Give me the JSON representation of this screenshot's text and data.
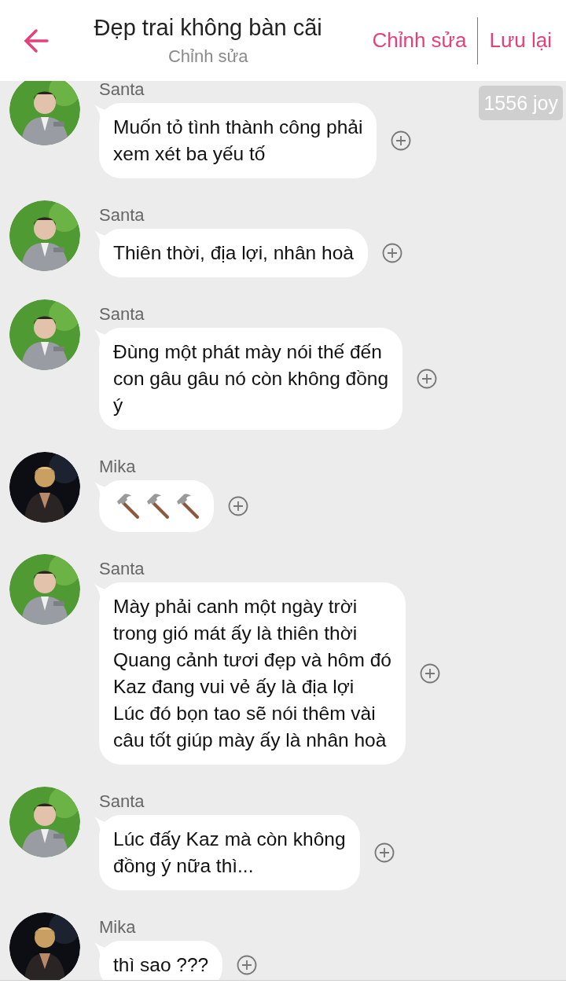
{
  "header": {
    "title": "Đẹp trai không bàn cãi",
    "subtitle": "Chỉnh sửa",
    "actions": [
      "Chỉnh sửa",
      "Lưu lại"
    ]
  },
  "badge": "1556 joy",
  "messages": [
    {
      "sender": "Santa",
      "color": "#4f9a32",
      "kind": "text",
      "text": "Muốn tỏ tình thành công phải\nxem xét ba yếu tố"
    },
    {
      "sender": "Santa",
      "color": "#4f9a32",
      "kind": "text",
      "text": "Thiên thời, địa lợi, nhân hoà"
    },
    {
      "sender": "Santa",
      "color": "#4f9a32",
      "kind": "text",
      "text": "Đùng một phát mày nói thế đến\ncon gâu gâu nó còn không đồng\ný"
    },
    {
      "sender": "Mika",
      "color": "#0d0e13",
      "kind": "icons",
      "icons": [
        {
          "kind": "hammer"
        },
        {
          "kind": "hammer"
        },
        {
          "kind": "hammer"
        }
      ]
    },
    {
      "sender": "Santa",
      "color": "#4f9a32",
      "kind": "text",
      "text": "Mày phải canh một ngày trời\ntrong gió mát ấy là thiên thời\nQuang cảnh tươi đẹp và hôm đó\nKaz đang vui vẻ ấy là địa lợi\nLúc đó bọn tao sẽ nói thêm vài\ncâu tốt giúp mày ấy là nhân hoà"
    },
    {
      "sender": "Santa",
      "color": "#4f9a32",
      "kind": "text",
      "text": "Lúc đấy Kaz mà còn không\nđồng ý nữa thì..."
    },
    {
      "sender": "Mika",
      "color": "#0d0e13",
      "kind": "text",
      "text": "thì sao ???"
    }
  ]
}
